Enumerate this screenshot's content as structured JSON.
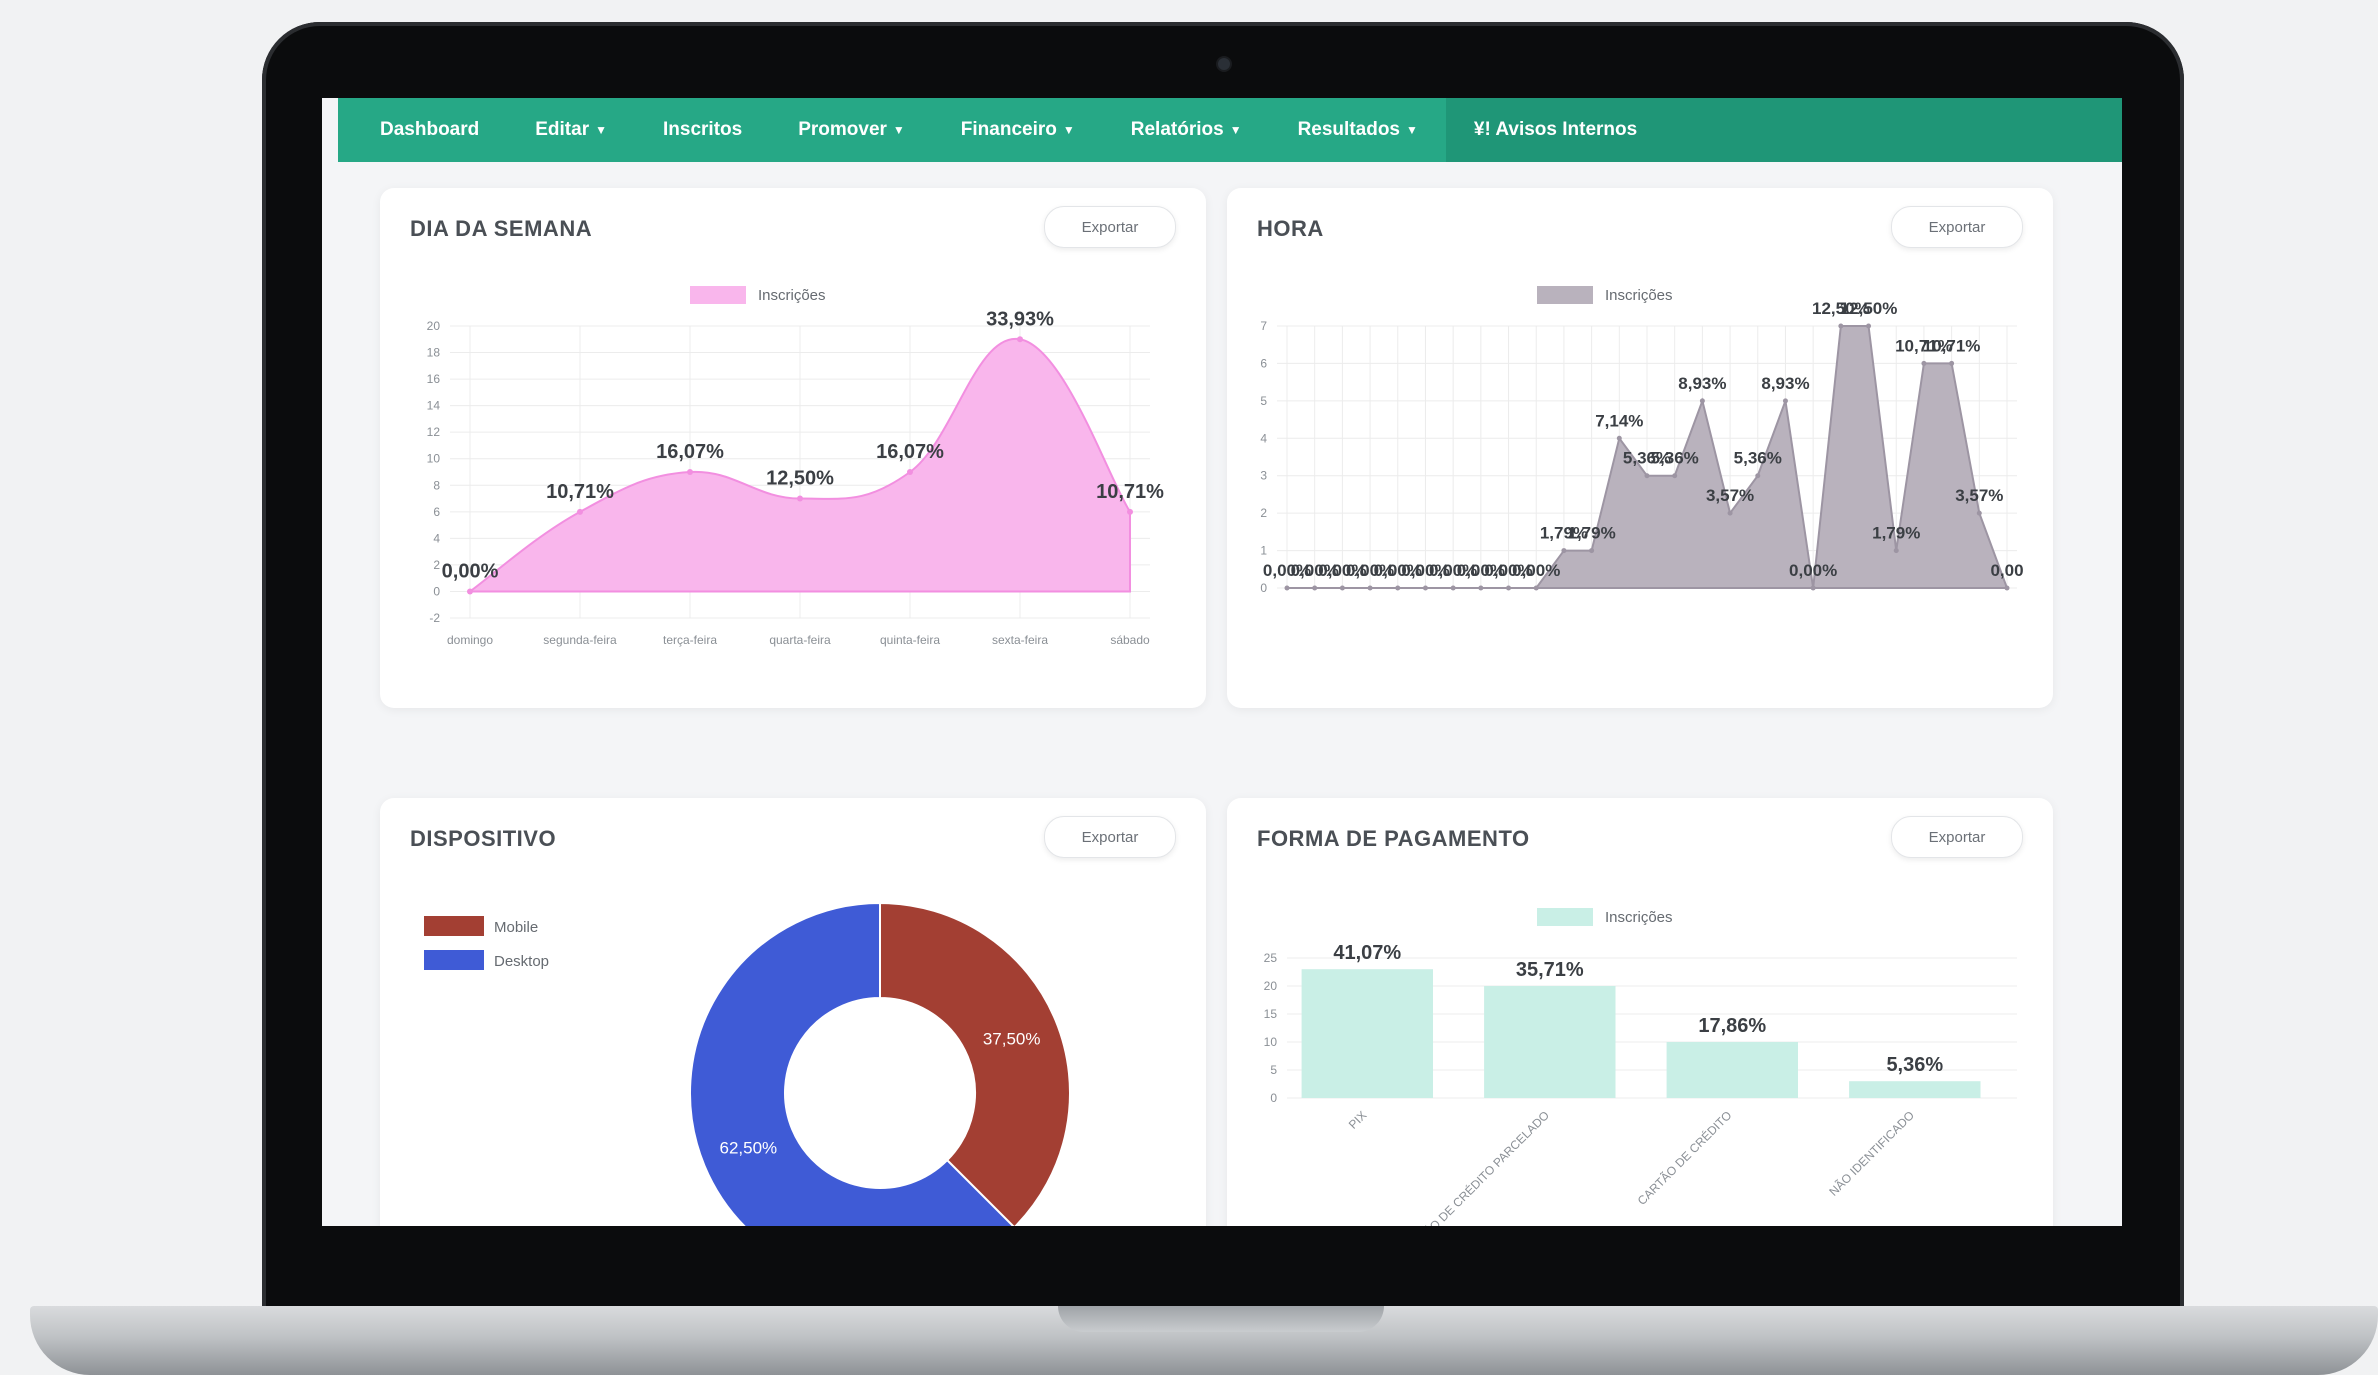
{
  "nav": {
    "items": [
      {
        "label": "Dashboard",
        "caret": ""
      },
      {
        "label": "Editar",
        "caret": "▼"
      },
      {
        "label": "Inscritos",
        "caret": ""
      },
      {
        "label": "Promover",
        "caret": "▼"
      },
      {
        "label": "Financeiro",
        "caret": "▼"
      },
      {
        "label": "Relatórios",
        "caret": "▼"
      },
      {
        "label": "Resultados",
        "caret": "▼"
      },
      {
        "label": "¥! Avisos Internos",
        "caret": ""
      }
    ],
    "colors": {
      "bar": "#26a886",
      "active": "#1f9677"
    }
  },
  "cards": {
    "dia_semana": {
      "title": "DIA DA SEMANA",
      "export_label": "Exportar"
    },
    "hora": {
      "title": "HORA",
      "export_label": "Exportar"
    },
    "dispositivo": {
      "title": "DISPOSITIVO",
      "export_label": "Exportar"
    },
    "pagamento": {
      "title": "FORMA DE PAGAMENTO",
      "export_label": "Exportar"
    }
  },
  "chart_data": [
    {
      "id": "dia_semana",
      "type": "area",
      "legend": [
        "Inscrições"
      ],
      "legend_position": "top",
      "categories": [
        "domingo",
        "segunda-feira",
        "terça-feira",
        "quarta-feira",
        "quinta-feira",
        "sexta-feira",
        "sábado"
      ],
      "values": [
        0,
        6,
        9,
        7,
        9,
        19,
        6
      ],
      "data_labels": [
        "0,00%",
        "10,71%",
        "16,07%",
        "12,50%",
        "16,07%",
        "33,93%",
        "10,71%"
      ],
      "yticks": [
        "-2",
        "0",
        "2",
        "4",
        "6",
        "8",
        "10",
        "12",
        "14",
        "16",
        "18",
        "20"
      ],
      "ylim": [
        -2,
        20
      ],
      "grid": true,
      "color": "#f9b6ec"
    },
    {
      "id": "hora",
      "type": "area",
      "legend": [
        "Inscrições"
      ],
      "legend_position": "top",
      "values": [
        0,
        0,
        0,
        0,
        0,
        0,
        0,
        0,
        0,
        0,
        1,
        1,
        4,
        3,
        3,
        5,
        2,
        3,
        5,
        0,
        7,
        7,
        1,
        6,
        6,
        2,
        0
      ],
      "data_labels": [
        "0,00%",
        "0,00%",
        "0,00%",
        "0,00%",
        "0,00%",
        "0,00%",
        "0,00%",
        "0,00%",
        "0,00%",
        "0,00%",
        "1,79%",
        "1,79%",
        "7,14%",
        "5,36%",
        "5,36%",
        "8,93%",
        "3,57%",
        "5,36%",
        "8,93%",
        "0,00%",
        "12,50%",
        "12,50%",
        "1,79%",
        "10,71%",
        "10,71%",
        "3,57%",
        "0,00"
      ],
      "yticks": [
        "0",
        "1",
        "2",
        "3",
        "4",
        "5",
        "6",
        "7"
      ],
      "ylim": [
        0,
        7
      ],
      "grid": true,
      "color": "#b9b2bd"
    },
    {
      "id": "dispositivo",
      "type": "pie",
      "legend": [
        "Mobile",
        "Desktop"
      ],
      "legend_position": "top-left",
      "values": [
        37.5,
        62.5
      ],
      "data_labels": [
        "37,50%",
        "62,50%"
      ],
      "colors": [
        "#a33f33",
        "#3f5bd6"
      ]
    },
    {
      "id": "pagamento",
      "type": "bar",
      "legend": [
        "Inscrições"
      ],
      "legend_position": "top",
      "categories": [
        "PIX",
        "CARTÃO DE CRÉDITO PARCELADO",
        "CARTÃO DE CRÉDITO",
        "NÃO IDENTIFICADO"
      ],
      "values": [
        23,
        20,
        10,
        3
      ],
      "data_labels": [
        "41,07%",
        "35,71%",
        "17,86%",
        "5,36%"
      ],
      "yticks": [
        "0",
        "5",
        "10",
        "15",
        "20",
        "25"
      ],
      "ylim": [
        0,
        25
      ],
      "grid": true,
      "color": "#c9efe6"
    }
  ]
}
